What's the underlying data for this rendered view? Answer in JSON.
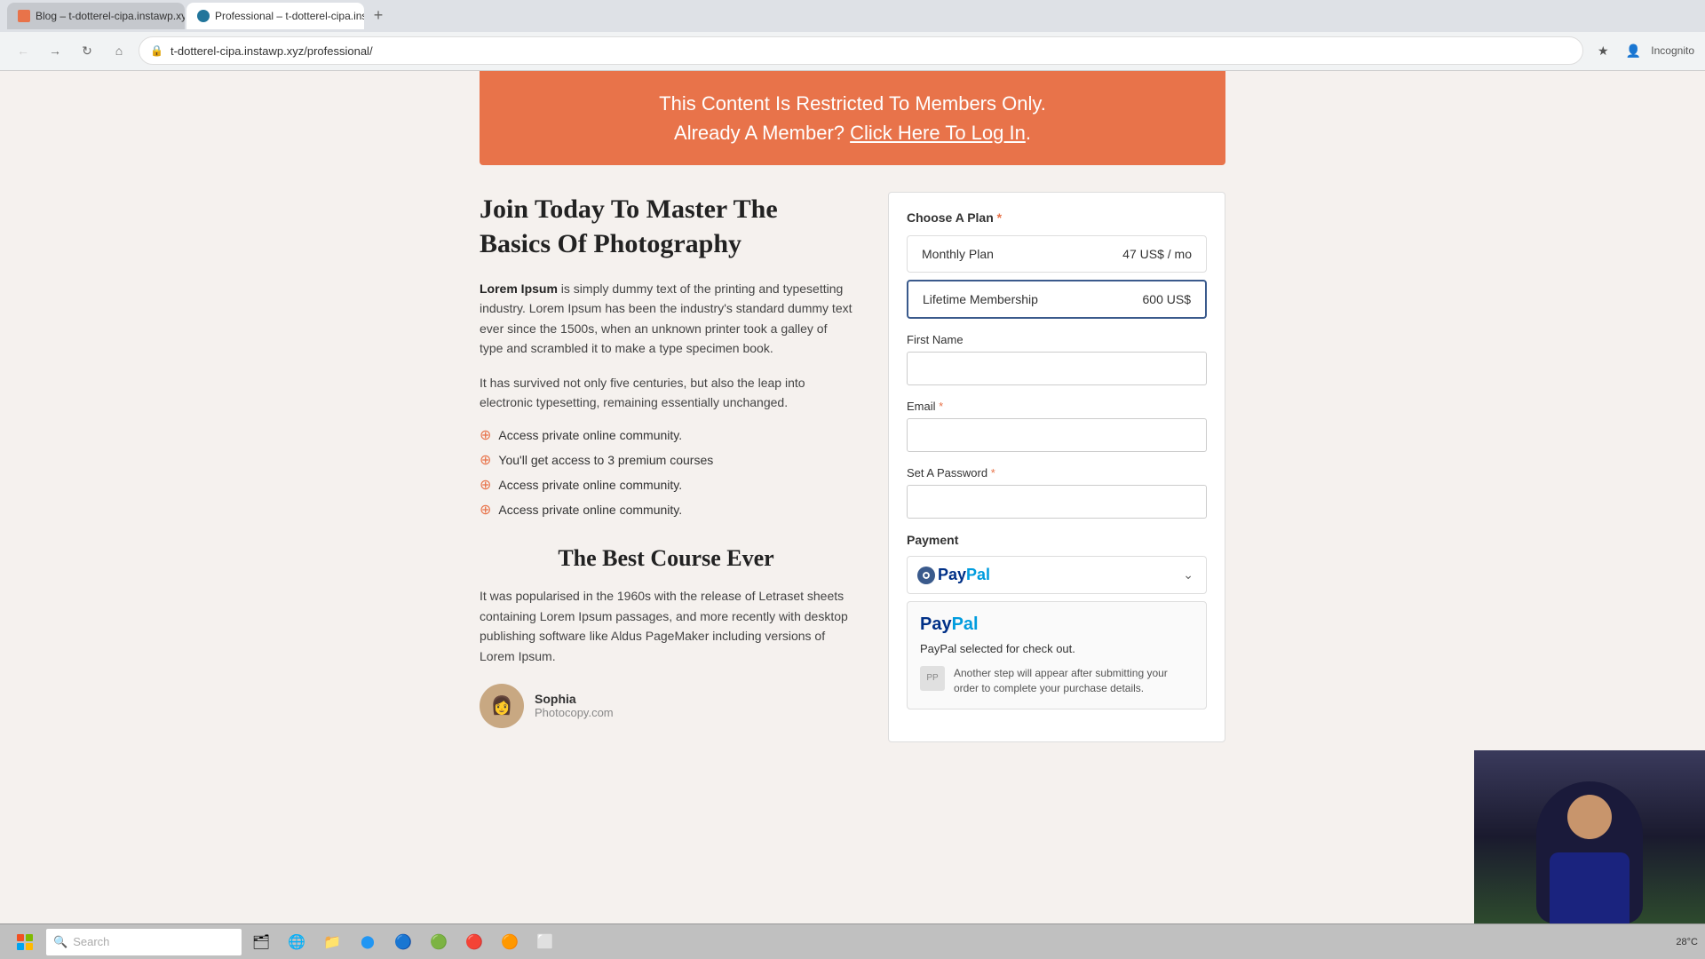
{
  "browser": {
    "tabs": [
      {
        "id": "tab1",
        "label": "Blog – t-dotterel-cipa.instawp.xy...",
        "favicon_type": "blog",
        "active": false
      },
      {
        "id": "tab2",
        "label": "Professional – t-dotterel-cipa.ins...",
        "favicon_type": "wp",
        "active": true
      }
    ],
    "new_tab_label": "+",
    "address": "t-dotterel-cipa.instawp.xyz/professional/",
    "incognito_label": "Incognito"
  },
  "banner": {
    "line1": "This Content Is Restricted To Members Only.",
    "line2": "Already A Member?",
    "link_text": "Click Here To Log In",
    "period": "."
  },
  "left": {
    "title": "Join Today To Master The Basics Of Photography",
    "para1_strong": "Lorem Ipsum",
    "para1_rest": " is simply dummy text of the printing and typesetting industry. Lorem Ipsum has been the industry's standard dummy text ever since the 1500s, when an unknown printer took a galley of type and scrambled it to make a type specimen book.",
    "para2": "It has survived not only five centuries, but also the leap into electronic typesetting, remaining essentially unchanged.",
    "features": [
      "Access private online community.",
      "You'll get access to 3 premium courses",
      "Access private online community.",
      "Access private online community."
    ],
    "section_title": "The Best Course Ever",
    "course_text": "It was popularised in the 1960s with the release of Letraset sheets containing Lorem Ipsum passages, and more recently with desktop publishing software like Aldus PageMaker including versions of Lorem Ipsum.",
    "testimonial_name": "Sophia",
    "testimonial_company": "Photocopy.com"
  },
  "form": {
    "plan_section_label": "Choose A Plan",
    "plans": [
      {
        "id": "monthly",
        "name": "Monthly Plan",
        "price": "47 US$ / mo",
        "selected": false
      },
      {
        "id": "lifetime",
        "name": "Lifetime Membership",
        "price": "600 US$",
        "selected": true
      }
    ],
    "first_name_label": "First Name",
    "email_label": "Email",
    "password_label": "Set A Password",
    "payment_label": "Payment",
    "paypal_label": "PayPal",
    "paypal_selected_text": "PayPal selected for check out.",
    "paypal_note": "Another step will appear after submitting your order to complete your purchase details."
  },
  "taskbar": {
    "search_placeholder": "Search",
    "time": "28°C",
    "apps": [
      "🗂",
      "🌐",
      "📁",
      "🔵",
      "🟠",
      "🔷",
      "🟢",
      "🔴"
    ]
  }
}
